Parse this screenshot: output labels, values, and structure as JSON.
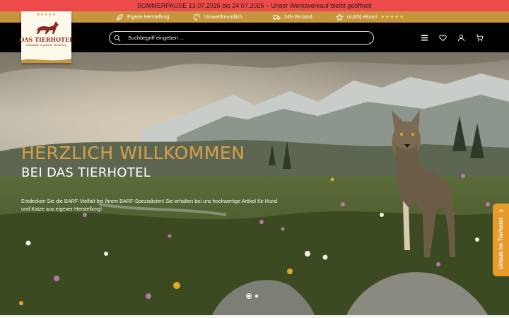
{
  "announcement": "SOMMERPAUSE 13.07.2026 bis 24.07.2026 – Unser Werksverkauf bleibt geöffnet!",
  "usp": [
    {
      "icon": "leaf-icon",
      "label": "Eigene Herstellung"
    },
    {
      "icon": "recycle-icon",
      "label": "Umweltfreundlich"
    },
    {
      "icon": "truck-icon",
      "label": "24h-Versand"
    },
    {
      "icon": "star-outline-icon",
      "label": "(4,8/5) eKomi",
      "stars": "★★★★★"
    }
  ],
  "logo": {
    "name": "DAS TIERHOTEL",
    "tagline": "Manufaktur für gesunde Tiernahrung",
    "stars": "★★★★★"
  },
  "search": {
    "placeholder": "Suchbegriff eingeben ..."
  },
  "header_icons": [
    "menu-icon",
    "heart-icon",
    "user-icon",
    "cart-icon"
  ],
  "hero": {
    "title": "HERZLICH WILLKOMMEN",
    "subtitle": "BEI DAS TIERHOTEL",
    "text": "Entdecken Sie die BARF-Vielfalt bei Ihrem BARF-Spezialisten! Sie erhalten bei uns hochwertige Artikel für Hund und Katze aus eigener Herstellung!",
    "slides": 2,
    "active_slide": 1
  },
  "side_tab": {
    "label": "Urlaub im Tierhotel"
  },
  "colors": {
    "announcement_bg": "#ee4a4c",
    "usp_bg": "#c8953e",
    "header_bg": "#000000",
    "title_gold": "#d9a04a",
    "side_tab_bg": "#e89a2a"
  }
}
